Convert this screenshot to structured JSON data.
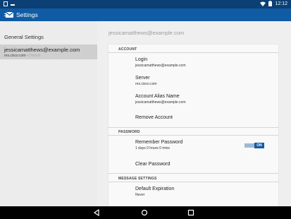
{
  "status_bar": {
    "time": "12:12"
  },
  "app_bar": {
    "title": "Settings"
  },
  "left_pane": {
    "header": "General Settings",
    "account": {
      "email": "jessicamatthews@example.com",
      "server": "res.cisco.com - ",
      "server_suffix": "Default"
    }
  },
  "right_pane": {
    "header": "jessicamatthews@example.com",
    "sections": {
      "account": "ACCOUNT",
      "password": "PASSWORD",
      "message_settings": "MESSAGE SETTINGS"
    },
    "rows": {
      "login": {
        "title": "Login",
        "value": "jessicamatthews@example.com"
      },
      "server": {
        "title": "Server",
        "value": "res.cisco.com"
      },
      "alias": {
        "title": "Account Alias Name",
        "value": "jessicamatthews@example.com"
      },
      "remove": {
        "title": "Remove Account"
      },
      "remember": {
        "title": "Remember Password",
        "value": "1 days 0 hours 0 mins",
        "toggle_label": "ON",
        "toggle_on": true
      },
      "clear": {
        "title": "Clear Password"
      },
      "expiration": {
        "title": "Default Expiration",
        "value": "Never"
      }
    }
  },
  "colors": {
    "status_bar": "#0c3f73",
    "app_bar": "#0f5ca5",
    "toggle_on": "#0f5ca5",
    "selected_row": "#cfcfcf"
  },
  "icons": {
    "app": "envelope-icon",
    "nav": [
      "back-icon",
      "home-icon",
      "recents-icon"
    ]
  }
}
